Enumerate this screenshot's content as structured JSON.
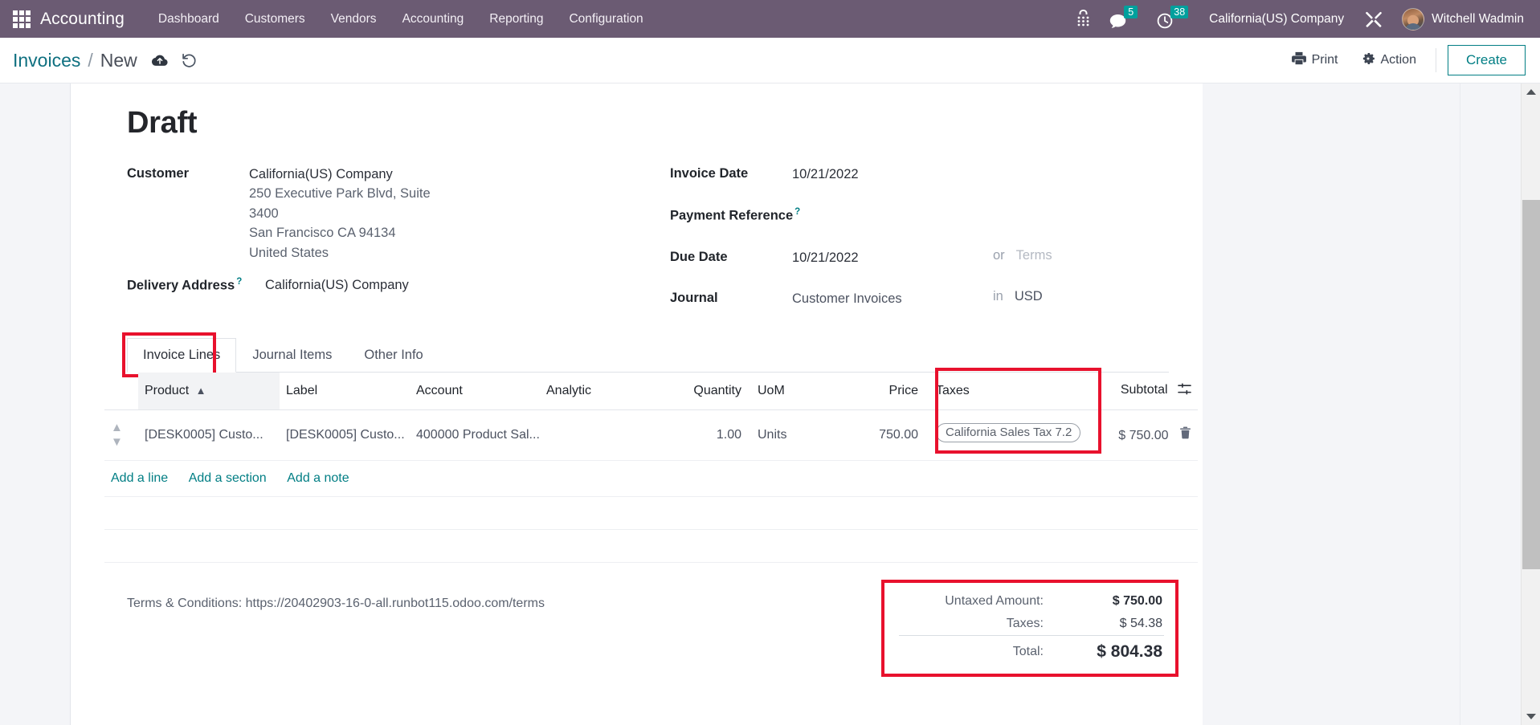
{
  "navbar": {
    "apps_icon": "apps-grid-icon",
    "brand": "Accounting",
    "menu": [
      {
        "label": "Dashboard"
      },
      {
        "label": "Customers"
      },
      {
        "label": "Vendors"
      },
      {
        "label": "Accounting"
      },
      {
        "label": "Reporting"
      },
      {
        "label": "Configuration"
      }
    ],
    "voip_icon": "phone-keypad-icon",
    "messages_icon": "chat-bubble-icon",
    "messages_count": "5",
    "activities_icon": "clock-icon",
    "activities_count": "38",
    "company": "California(US) Company",
    "debug_icon": "wrench-tools-icon",
    "user": "Witchell Wadmin",
    "accent_badge_color": "#00a09d",
    "navbar_color": "#6b5b73"
  },
  "control_panel": {
    "breadcrumb_root": "Invoices",
    "breadcrumb_sep": "/",
    "breadcrumb_current": "New",
    "save_icon": "cloud-upload-icon",
    "discard_icon": "discard-undo-icon",
    "print_label": "Print",
    "print_icon": "printer-icon",
    "action_label": "Action",
    "action_icon": "gear-icon",
    "create_label": "Create",
    "create_color": "#017e84"
  },
  "form": {
    "status": "Draft",
    "left": {
      "customer_label": "Customer",
      "customer_value": "California(US) Company",
      "customer_address": [
        "250 Executive Park Blvd, Suite 3400",
        "San Francisco CA 94134",
        "United States"
      ],
      "delivery_address_label": "Delivery Address",
      "delivery_address_tip": "?",
      "delivery_address_value": "California(US) Company"
    },
    "right": {
      "invoice_date_label": "Invoice Date",
      "invoice_date_value": "10/21/2022",
      "payment_reference_label": "Payment Reference",
      "payment_reference_tip": "?",
      "payment_reference_value": "",
      "due_date_label": "Due Date",
      "due_date_value": "10/21/2022",
      "due_date_or": "or",
      "due_date_terms_placeholder": "Terms",
      "journal_label": "Journal",
      "journal_value": "Customer Invoices",
      "journal_in": "in",
      "journal_currency": "USD"
    }
  },
  "tabs": [
    {
      "label": "Invoice Lines",
      "active": true,
      "highlighted": true
    },
    {
      "label": "Journal Items",
      "active": false,
      "highlighted": false
    },
    {
      "label": "Other Info",
      "active": false,
      "highlighted": false
    }
  ],
  "lines_table": {
    "columns": [
      {
        "label": "Product",
        "sorted": true,
        "sort_icon": "caret-up-icon"
      },
      {
        "label": "Label"
      },
      {
        "label": "Account"
      },
      {
        "label": "Analytic"
      },
      {
        "label": "Quantity"
      },
      {
        "label": "UoM"
      },
      {
        "label": "Price"
      },
      {
        "label": "Taxes",
        "highlighted": true
      },
      {
        "label": "Subtotal",
        "settings_icon": "column-settings-icon"
      }
    ],
    "rows": [
      {
        "handle_icon": "drag-handle-icon",
        "product": "[DESK0005] Custo...",
        "label": "[DESK0005] Custo...",
        "account": "400000 Product Sal...",
        "analytic": "",
        "quantity": "1.00",
        "uom": "Units",
        "price": "750.00",
        "taxes": "California Sales Tax 7.2",
        "subtotal": "$ 750.00",
        "delete_icon": "trash-icon"
      }
    ],
    "add_line": "Add a line",
    "add_section": "Add a section",
    "add_note": "Add a note"
  },
  "footer": {
    "terms": "Terms & Conditions: https://20402903-16-0-all.runbot115.odoo.com/terms",
    "totals": {
      "untaxed_label": "Untaxed Amount:",
      "untaxed_value": "$ 750.00",
      "taxes_label": "Taxes:",
      "taxes_value": "$ 54.38",
      "total_label": "Total:",
      "total_value": "$ 804.38"
    },
    "highlight_color": "#e8112d"
  },
  "scrollbar": {
    "up_icon": "scroll-up-arrow",
    "down_icon": "scroll-down-arrow"
  }
}
